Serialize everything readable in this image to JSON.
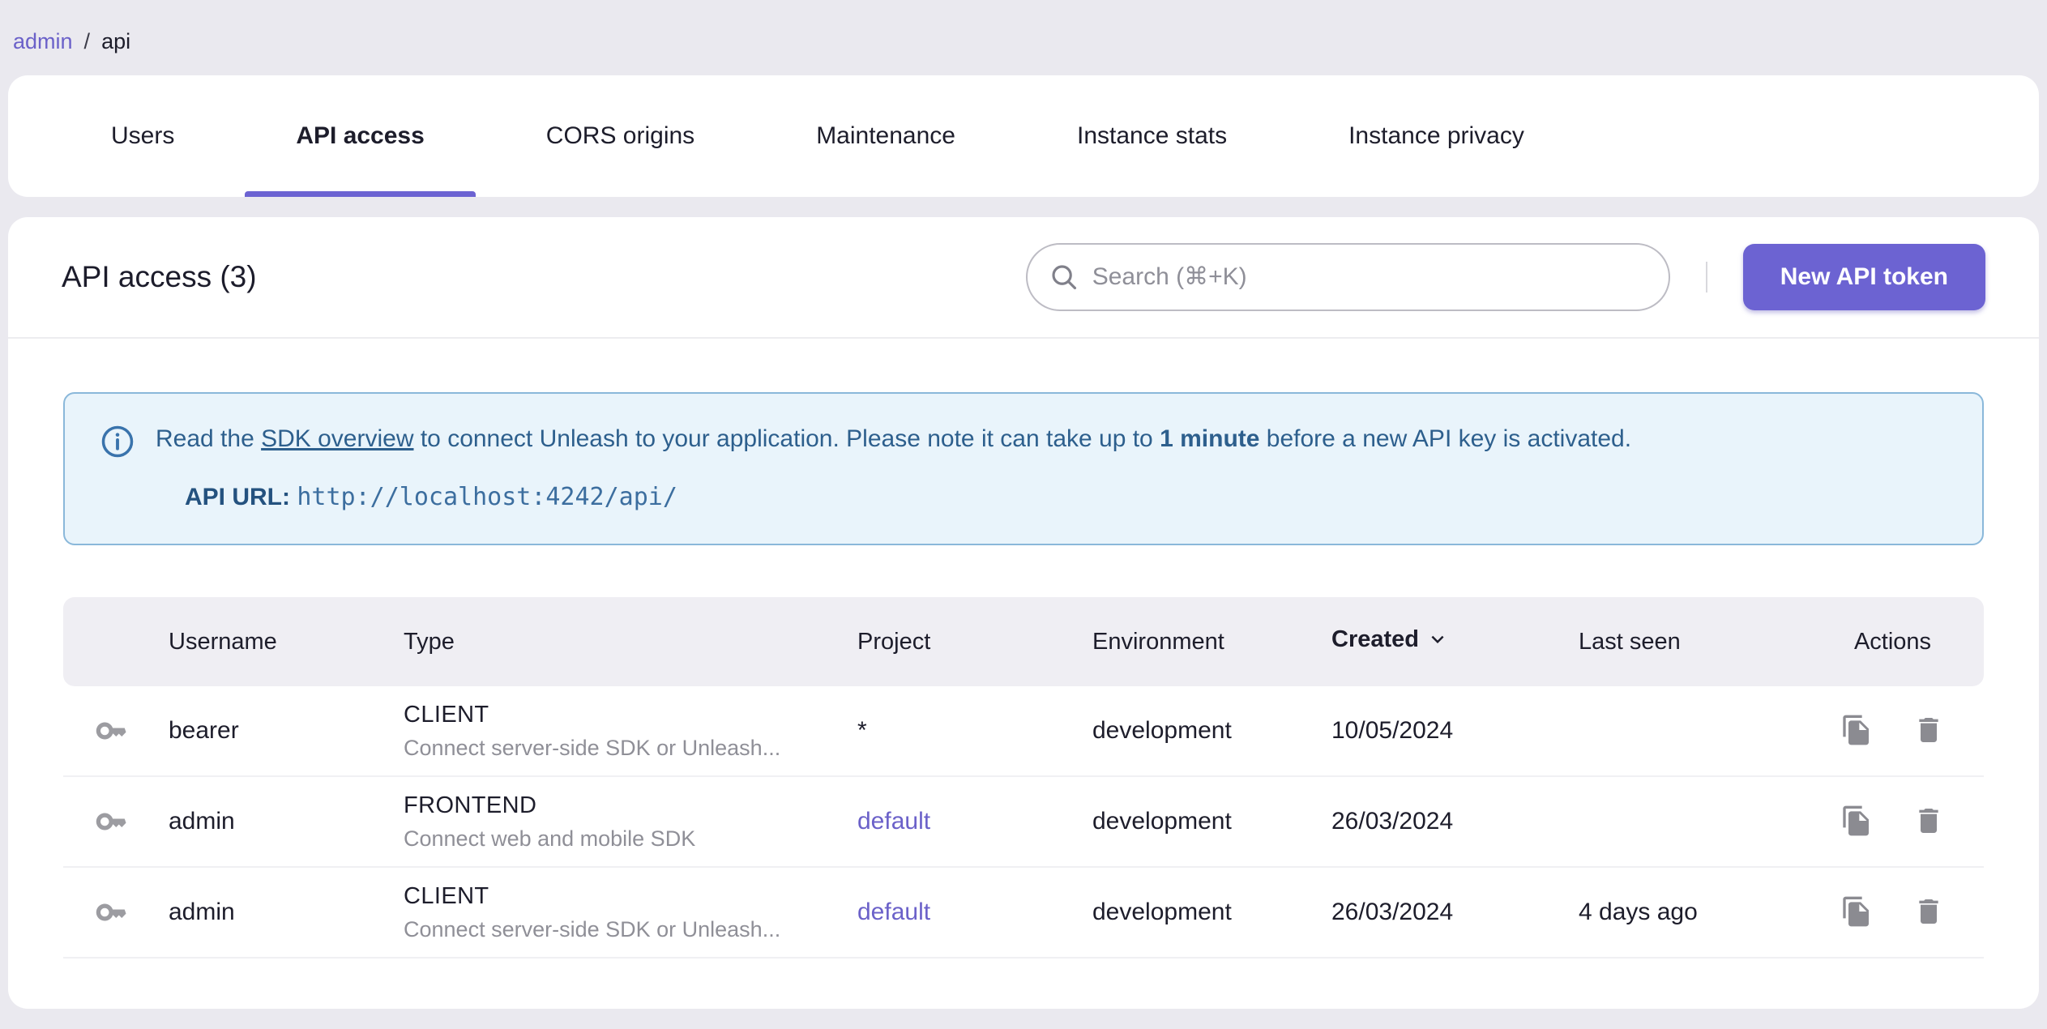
{
  "breadcrumb": {
    "link": "admin",
    "separator": "/",
    "current": "api"
  },
  "tabs": [
    {
      "label": "Users",
      "active": false
    },
    {
      "label": "API access",
      "active": true
    },
    {
      "label": "CORS origins",
      "active": false
    },
    {
      "label": "Maintenance",
      "active": false
    },
    {
      "label": "Instance stats",
      "active": false
    },
    {
      "label": "Instance privacy",
      "active": false
    }
  ],
  "header": {
    "title": "API access (3)",
    "search_placeholder": "Search (⌘+K)",
    "new_token_label": "New API token"
  },
  "info": {
    "line1_prefix": "Read the ",
    "line1_link": "SDK overview",
    "line1_mid": " to connect Unleash to your application. Please note it can take up to ",
    "line1_bold": "1 minute",
    "line1_suffix": " before a new API key is activated.",
    "api_url_label": "API URL",
    "api_url_separator": ": ",
    "api_url": "http://localhost:4242/api/"
  },
  "table": {
    "columns": [
      "",
      "Username",
      "Type",
      "Project",
      "Environment",
      "Created",
      "Last seen",
      "Actions"
    ],
    "sorted_column": "Created",
    "sort_direction": "desc",
    "rows": [
      {
        "username": "bearer",
        "type": "CLIENT",
        "type_description": "Connect server-side SDK or Unleash...",
        "project": "*",
        "project_is_link": false,
        "environment": "development",
        "created": "10/05/2024",
        "last_seen": ""
      },
      {
        "username": "admin",
        "type": "FRONTEND",
        "type_description": "Connect web and mobile SDK",
        "project": "default",
        "project_is_link": true,
        "environment": "development",
        "created": "26/03/2024",
        "last_seen": ""
      },
      {
        "username": "admin",
        "type": "CLIENT",
        "type_description": "Connect server-side SDK or Unleash...",
        "project": "default",
        "project_is_link": true,
        "environment": "development",
        "created": "26/03/2024",
        "last_seen": "4 days ago"
      }
    ]
  },
  "icons": {
    "search": "search-icon",
    "info": "info-icon",
    "key": "key-icon",
    "copy": "copy-icon",
    "delete": "delete-icon",
    "sort": "sort-desc-icon"
  },
  "colors": {
    "page_background": "#eae9ef",
    "card_background": "#ffffff",
    "accent_purple": "#6c63d2",
    "link_purple": "#6b61c9",
    "info_background": "#e9f4fb",
    "info_border": "#8ab8da",
    "info_text": "#2d5f8d",
    "table_header_background": "#efeef3",
    "text_primary": "#1d1d2b",
    "text_secondary": "#8f8f97",
    "icon_gray": "#8b8b91"
  }
}
